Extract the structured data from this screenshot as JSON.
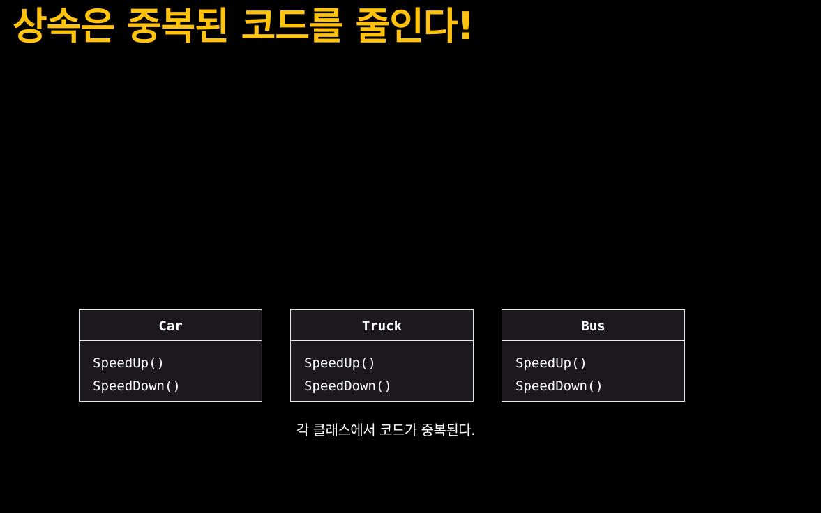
{
  "slide": {
    "title": "상속은 중복된 코드를 줄인다!",
    "caption": "각 클래스에서 코드가 중복된다."
  },
  "classes": [
    {
      "name": "Car",
      "methods": [
        "SpeedUp()",
        "SpeedDown()"
      ]
    },
    {
      "name": "Truck",
      "methods": [
        "SpeedUp()",
        "SpeedDown()"
      ]
    },
    {
      "name": "Bus",
      "methods": [
        "SpeedUp()",
        "SpeedDown()"
      ]
    }
  ],
  "colors": {
    "title": "#ffc20e",
    "background": "#000000",
    "box_fill": "#1b191e",
    "box_border": "#e8e8e8",
    "text": "#ffffff"
  }
}
